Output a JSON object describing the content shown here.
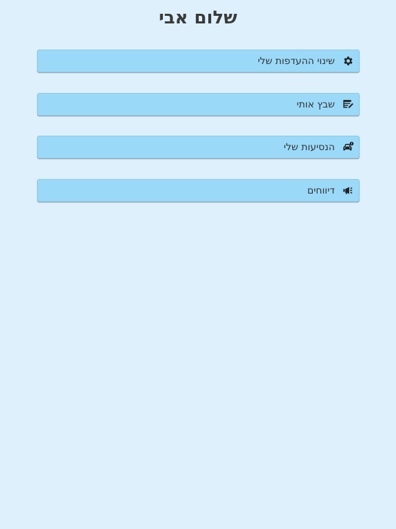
{
  "header": {
    "title": "שלום אבי"
  },
  "menu": {
    "items": [
      {
        "label": "שינוי ההעדפות שלי",
        "icon": "gear-icon"
      },
      {
        "label": "שבץ אותי",
        "icon": "edit-note-icon"
      },
      {
        "label": "הנסיעות שלי",
        "icon": "car-alert-icon"
      },
      {
        "label": "דיווחים",
        "icon": "megaphone-icon"
      }
    ]
  },
  "colors": {
    "background": "#ddf0fc",
    "button": "#9bd9f8",
    "text": "#333333"
  }
}
